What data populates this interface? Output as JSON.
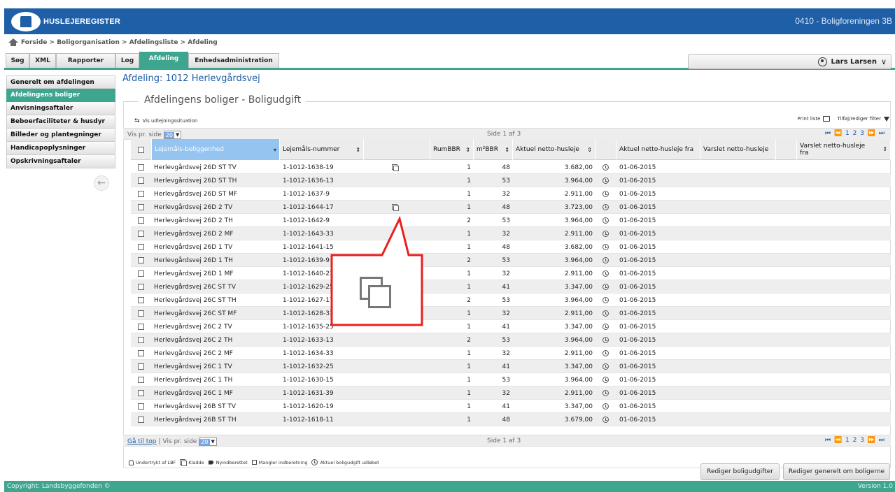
{
  "app": {
    "logo_text": "HUSLEJEREGISTER",
    "organization": "0410 - Boligforeningen 3B"
  },
  "breadcrumb": "Forside > Boligorganisation > Afdelingsliste > Afdeling",
  "tabs": [
    {
      "label": "Søg",
      "active": false
    },
    {
      "label": "XML",
      "active": false
    },
    {
      "label": "Rapporter",
      "active": false
    },
    {
      "label": "Log",
      "active": false
    },
    {
      "label": "Afdeling",
      "active": true
    },
    {
      "label": "Enhedsadministration",
      "active": false
    }
  ],
  "user": {
    "name": "Lars Larsen"
  },
  "sidebar": {
    "items": [
      {
        "label": "Generelt om afdelingen",
        "active": false
      },
      {
        "label": "Afdelingens boliger",
        "active": true
      },
      {
        "label": "Anvisningsaftaler",
        "active": false
      },
      {
        "label": "Beboerfaciliteter & husdyr",
        "active": false
      },
      {
        "label": "Billeder og plantegninger",
        "active": false
      },
      {
        "label": "Handicapoplysninger",
        "active": false
      },
      {
        "label": "Opskrivningsaftaler",
        "active": false
      }
    ]
  },
  "page": {
    "title": "Afdeling: 1012 Herlevgårdsvej",
    "section_title": "Afdelingens boliger - Boligudgift"
  },
  "toolbar": {
    "vis_udlejning": "Vis udlejningssituation",
    "print_label": "Print liste",
    "filter_label": "Tilføj/rediger filter"
  },
  "pager": {
    "per_page_label": "Vis pr. side",
    "per_page_value": "20",
    "page_info": "Side 1 af 3",
    "pages": "⏮ ⏪ 1 2 3 ⏩ ⏭",
    "go_top": "Gå til top",
    "separator": "|"
  },
  "columns": {
    "lejemaal": "Lejemåls-beliggenhed",
    "nummer": "Lejemåls-nummer",
    "rum": "RumBBR",
    "m2": "m²BBR",
    "husleje": "Aktuel netto-husleje",
    "fra": "Aktuel netto-husleje fra",
    "varslet": "Varslet netto-husleje",
    "varslet_fra": "Varslet netto-husleje fra"
  },
  "rows": [
    {
      "addr": "Herlevgårdsvej 26D ST TV",
      "nr": "1-1012-1638-19",
      "copy": true,
      "rum": "1",
      "m2": "48",
      "leje": "3.682,00",
      "fra": "01-06-2015"
    },
    {
      "addr": "Herlevgårdsvej 26D ST TH",
      "nr": "1-1012-1636-13",
      "copy": false,
      "rum": "1",
      "m2": "53",
      "leje": "3.964,00",
      "fra": "01-06-2015"
    },
    {
      "addr": "Herlevgårdsvej 26D ST MF",
      "nr": "1-1012-1637-9",
      "copy": false,
      "rum": "1",
      "m2": "32",
      "leje": "2.911,00",
      "fra": "01-06-2015"
    },
    {
      "addr": "Herlevgårdsvej 26D 2 TV",
      "nr": "1-1012-1644-17",
      "copy": true,
      "rum": "1",
      "m2": "48",
      "leje": "3.723,00",
      "fra": "01-06-2015"
    },
    {
      "addr": "Herlevgårdsvej 26D 2 TH",
      "nr": "1-1012-1642-9",
      "copy": false,
      "rum": "2",
      "m2": "53",
      "leje": "3.964,00",
      "fra": "01-06-2015"
    },
    {
      "addr": "Herlevgårdsvej 26D 2 MF",
      "nr": "1-1012-1643-33",
      "copy": false,
      "rum": "1",
      "m2": "32",
      "leje": "2.911,00",
      "fra": "01-06-2015"
    },
    {
      "addr": "Herlevgårdsvej 26D 1 TV",
      "nr": "1-1012-1641-15",
      "copy": false,
      "rum": "1",
      "m2": "48",
      "leje": "3.682,00",
      "fra": "01-06-2015"
    },
    {
      "addr": "Herlevgårdsvej 26D 1 TH",
      "nr": "1-1012-1639-9",
      "copy": false,
      "rum": "2",
      "m2": "53",
      "leje": "3.964,00",
      "fra": "01-06-2015"
    },
    {
      "addr": "Herlevgårdsvej 26D 1 MF",
      "nr": "1-1012-1640-23",
      "copy": false,
      "rum": "1",
      "m2": "32",
      "leje": "2.911,00",
      "fra": "01-06-2015"
    },
    {
      "addr": "Herlevgårdsvej 26C ST TV",
      "nr": "1-1012-1629-25",
      "copy": false,
      "rum": "1",
      "m2": "41",
      "leje": "3.347,00",
      "fra": "01-06-2015"
    },
    {
      "addr": "Herlevgårdsvej 26C ST TH",
      "nr": "1-1012-1627-17",
      "copy": false,
      "rum": "2",
      "m2": "53",
      "leje": "3.964,00",
      "fra": "01-06-2015"
    },
    {
      "addr": "Herlevgårdsvej 26C ST MF",
      "nr": "1-1012-1628-33",
      "copy": false,
      "rum": "1",
      "m2": "32",
      "leje": "2.911,00",
      "fra": "01-06-2015"
    },
    {
      "addr": "Herlevgårdsvej 26C 2 TV",
      "nr": "1-1012-1635-25",
      "copy": false,
      "rum": "1",
      "m2": "41",
      "leje": "3.347,00",
      "fra": "01-06-2015"
    },
    {
      "addr": "Herlevgårdsvej 26C 2 TH",
      "nr": "1-1012-1633-13",
      "copy": false,
      "rum": "2",
      "m2": "53",
      "leje": "3.964,00",
      "fra": "01-06-2015"
    },
    {
      "addr": "Herlevgårdsvej 26C 2 MF",
      "nr": "1-1012-1634-33",
      "copy": false,
      "rum": "1",
      "m2": "32",
      "leje": "2.911,00",
      "fra": "01-06-2015"
    },
    {
      "addr": "Herlevgårdsvej 26C 1 TV",
      "nr": "1-1012-1632-25",
      "copy": false,
      "rum": "1",
      "m2": "41",
      "leje": "3.347,00",
      "fra": "01-06-2015"
    },
    {
      "addr": "Herlevgårdsvej 26C 1 TH",
      "nr": "1-1012-1630-15",
      "copy": false,
      "rum": "1",
      "m2": "53",
      "leje": "3.964,00",
      "fra": "01-06-2015"
    },
    {
      "addr": "Herlevgårdsvej 26C 1 MF",
      "nr": "1-1012-1631-39",
      "copy": false,
      "rum": "1",
      "m2": "32",
      "leje": "2.911,00",
      "fra": "01-06-2015"
    },
    {
      "addr": "Herlevgårdsvej 26B ST TV",
      "nr": "1-1012-1620-19",
      "copy": false,
      "rum": "1",
      "m2": "41",
      "leje": "3.347,00",
      "fra": "01-06-2015"
    },
    {
      "addr": "Herlevgårdsvej 26B ST TH",
      "nr": "1-1012-1618-11",
      "copy": false,
      "rum": "1",
      "m2": "48",
      "leje": "3.679,00",
      "fra": "01-06-2015"
    }
  ],
  "legend": {
    "undertrykt": "Undertrykt af LBF",
    "kladde": "Kladde",
    "nyindberettet": "Nyindberettet",
    "mangler": "Mangler indberetning",
    "udlobet": "Aktuel boligudgift udløbet"
  },
  "buttons": {
    "rediger_boligudgifter": "Rediger boligudgifter",
    "rediger_generelt": "Rediger generelt om boligerne"
  },
  "footer": {
    "copyright": "Copyright: Landsbyggefonden ©",
    "version": "Version 1.0"
  },
  "colors": {
    "header_blue": "#1e5fa8",
    "accent_green": "#3ea58f",
    "callout_red": "#e8201e"
  },
  "icons": [
    "home-icon",
    "user-icon",
    "chevron-down-icon",
    "back-arrow-icon",
    "refresh-icon",
    "printer-icon",
    "filter-icon",
    "copy-icon",
    "clock-icon",
    "bell-icon",
    "tag-icon"
  ]
}
